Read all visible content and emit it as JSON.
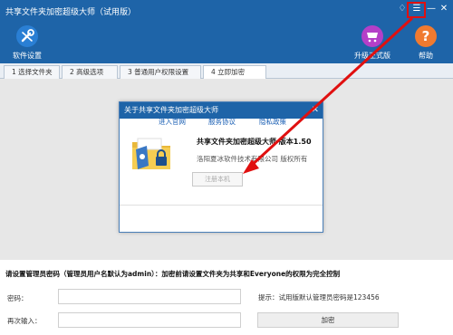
{
  "window": {
    "title": "共享文件夹加密超级大师（试用版）",
    "controls": {
      "skin": "♢",
      "menu": "☰",
      "minimize": "—",
      "close": "✕"
    }
  },
  "toolbar": {
    "folder_settings_label": "软件设置",
    "upgrade_label": "升级正式版",
    "help_label": "帮助"
  },
  "tabs": [
    {
      "label": "1 选择文件夹"
    },
    {
      "label": "2 高级选项"
    },
    {
      "label": "3 普通用户权限设置"
    },
    {
      "label": "4 立即加密"
    }
  ],
  "about_dialog": {
    "title": "关于共享文件夹加密超级大师",
    "product": "共享文件夹加密超级大师 版本1.50",
    "company": "洛阳夏冰软件技术有限公司 版权所有",
    "register_button": "注册本机",
    "links": [
      "进入官网",
      "服务协议",
      "隐私政策"
    ]
  },
  "form": {
    "instruction": "请设置管理员密码（管理员用户名默认为admin）：加密前请设置文件夹为共享和Everyone的权限为完全控制",
    "password_label": "密码：",
    "password_value": "",
    "confirm_label": "再次输入：",
    "confirm_value": "",
    "hint": "提示：试用版默认管理员密码是123456",
    "encrypt_button": "加密"
  },
  "colors": {
    "title_bar": "#1e64a8",
    "highlight_red": "#e01010",
    "upgrade_icon": "#b43fc8",
    "help_icon": "#f07a30",
    "settings_icon": "#2a7fd4"
  }
}
